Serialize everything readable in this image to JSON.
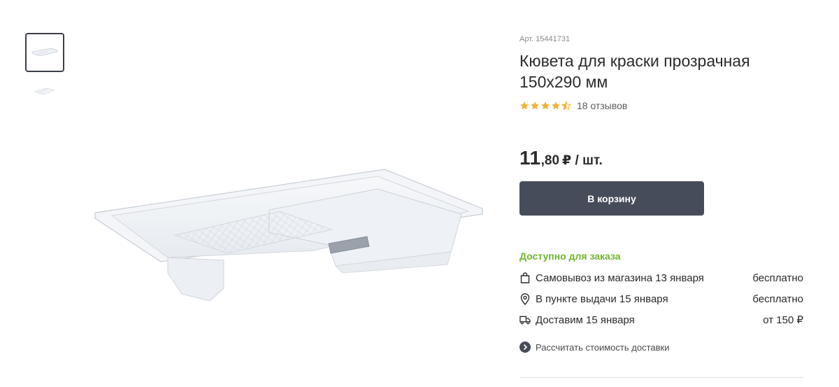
{
  "gallery": {
    "thumbnails": [
      {
        "icon": "paint-tray-thumbnail",
        "active": true
      },
      {
        "icon": "paint-tray-thumbnail",
        "active": false
      }
    ],
    "main_image_icon": "paint-tray-image"
  },
  "product": {
    "sku": "Арт. 15441731",
    "title_line1": "Кювета для краски прозрачная",
    "title_line2": "150x290 мм",
    "rating": 4.5,
    "reviews": "18 отзывов",
    "price_int": "11",
    "price_frac": ",80",
    "price_unit": "₽ / шт.",
    "cart_button": "В корзину"
  },
  "delivery": {
    "availability": "Доступно для заказа",
    "options": [
      {
        "icon": "shopping-bag-icon",
        "label": "Самовывоз из магазина 13 января",
        "price": "бесплатно"
      },
      {
        "icon": "map-pin-icon",
        "label": "В пункте выдачи 15 января",
        "price": "бесплатно"
      },
      {
        "icon": "truck-icon",
        "label": "Доставим 15 января",
        "price": "от 150 ₽"
      }
    ],
    "calc_link": "Рассчитать стоимость доставки"
  },
  "colors": {
    "accent_button": "#474c5a",
    "available_green": "#6fb52c",
    "star": "#f2b134"
  }
}
